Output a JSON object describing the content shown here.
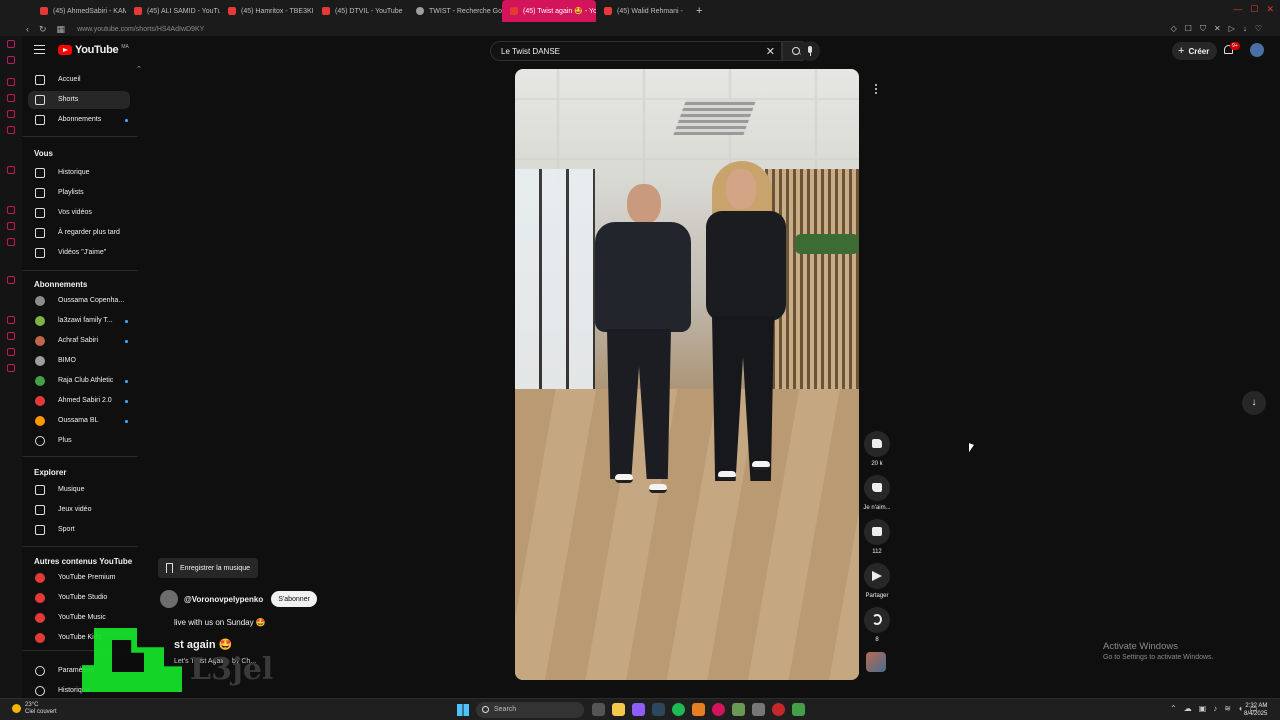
{
  "browser": {
    "tabs": [
      {
        "label": "(45) AhmedSabiri - KAM",
        "active": false
      },
      {
        "label": "(45) ALI SAMID - YouTub",
        "active": false
      },
      {
        "label": "(45) Hamritox - TBE3KI",
        "active": false
      },
      {
        "label": "(45) DTVIL - YouTube",
        "active": false
      },
      {
        "label": "TWIST - Recherche Goog",
        "active": false
      },
      {
        "label": "(45) Twist again 🤩 - Yo",
        "active": true
      },
      {
        "label": "(45) Walid Rehmani -",
        "active": false
      }
    ],
    "url": "www.youtube.com/shorts/HS4AdIwD9KY",
    "accent": "#d4145a"
  },
  "masthead": {
    "logo_text": "YouTube",
    "logo_country": "MA",
    "search_value": "Le Twist DANSE",
    "create_label": "Créer",
    "notification_count": "9+"
  },
  "sidebar": {
    "main": [
      {
        "label": "Accueil",
        "icon": "home-icon"
      },
      {
        "label": "Shorts",
        "icon": "shorts-icon",
        "active": true
      },
      {
        "label": "Abonnements",
        "icon": "subscriptions-icon",
        "dot": true
      }
    ],
    "you_header": "Vous",
    "you_items": [
      {
        "label": "Historique",
        "icon": "history-icon"
      },
      {
        "label": "Playlists",
        "icon": "playlists-icon"
      },
      {
        "label": "Vos vidéos",
        "icon": "your-videos-icon"
      },
      {
        "label": "À regarder plus tard",
        "icon": "watch-later-icon"
      },
      {
        "label": "Vidéos \"J'aime\"",
        "icon": "liked-videos-icon"
      }
    ],
    "subs_header": "Abonnements",
    "subs": [
      {
        "label": "Oussama Copenha...",
        "color": "#8d8d8d",
        "dot": false
      },
      {
        "label": "la3zawi family T...",
        "color": "#7cb342",
        "dot": true
      },
      {
        "label": "Achraf Sabiri",
        "color": "#c0644b",
        "dot": true
      },
      {
        "label": "BIMO",
        "color": "#9e9e9e",
        "dot": false
      },
      {
        "label": "Raja Club Athletic",
        "color": "#43a047",
        "dot": true
      },
      {
        "label": "Ahmed Sabiri 2.0",
        "color": "#e53935",
        "dot": true
      },
      {
        "label": "Oussama BL",
        "color": "#ff9800",
        "dot": true
      }
    ],
    "more_label": "Plus",
    "explore_header": "Explorer",
    "explore": [
      {
        "label": "Musique",
        "icon": "music-icon"
      },
      {
        "label": "Jeux vidéo",
        "icon": "gaming-icon"
      },
      {
        "label": "Sport",
        "icon": "sport-icon"
      }
    ],
    "other_header": "Autres contenus YouTube",
    "other": [
      {
        "label": "YouTube Premium"
      },
      {
        "label": "YouTube Studio"
      },
      {
        "label": "YouTube Music"
      },
      {
        "label": "YouTube Kids"
      }
    ],
    "settings": [
      {
        "label": "Paramètres",
        "icon": "settings-icon"
      },
      {
        "label": "Historique",
        "icon": "report-history-icon"
      }
    ]
  },
  "short": {
    "likes": "20 k",
    "dislike_label": "Je n'aim...",
    "comments": "112",
    "share_label": "Partager",
    "remix_count": "8",
    "save_music_label": "Enregistrer la musique",
    "channel": "@Voronovpelypenko",
    "subscribe_label": "S'abonner",
    "caption": "live with us on Sunday 🤩",
    "title": "st again 🤩",
    "song": "Let's Twist Again · by Ch..."
  },
  "overlay": {
    "logo_text": "L3jel"
  },
  "watermark": {
    "title": "Activate Windows",
    "subtitle": "Go to Settings to activate Windows."
  },
  "taskbar": {
    "temperature": "23°C",
    "weather": "Ciel couvert",
    "search_placeholder": "Search",
    "time": "2:32 AM",
    "date": "8/4/2025"
  }
}
